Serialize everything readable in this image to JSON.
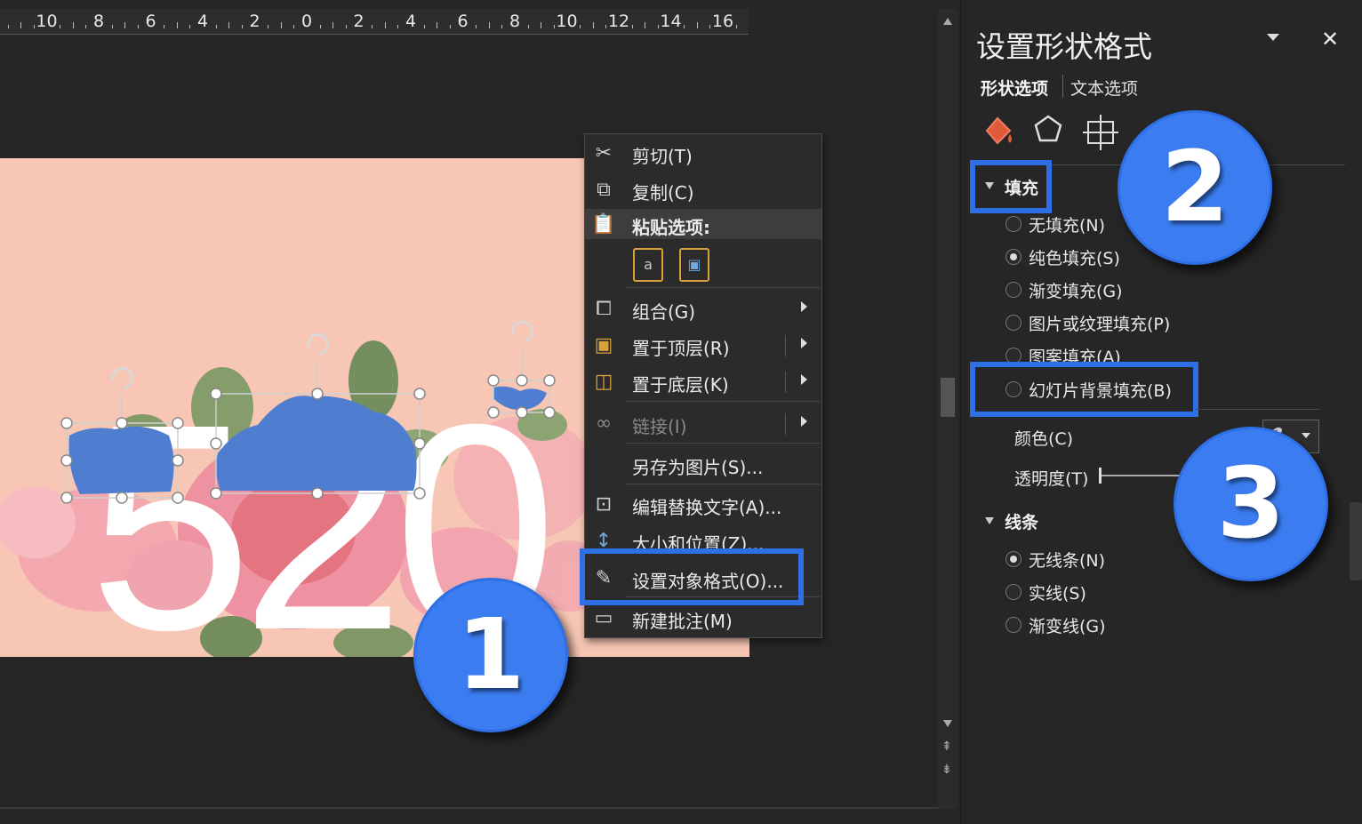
{
  "ruler": {
    "numbers": [
      "2",
      "10",
      "8",
      "6",
      "4",
      "2",
      "0",
      "2",
      "4",
      "6",
      "8",
      "10",
      "12",
      "14",
      "16"
    ]
  },
  "slide": {
    "big_text": "520",
    "background": "#f7c6b4",
    "shape_color": "#4f7dcf"
  },
  "context_menu": {
    "items": [
      {
        "label": "剪切(T)",
        "icon": "scissors-icon"
      },
      {
        "label": "复制(C)",
        "icon": "copy-icon"
      },
      {
        "label": "粘贴选项:",
        "icon": "paste-icon"
      },
      {
        "label": "组合(G)",
        "icon": "group-icon"
      },
      {
        "label": "置于顶层(R)",
        "icon": "bring-to-front-icon"
      },
      {
        "label": "置于底层(K)",
        "icon": "send-to-back-icon"
      },
      {
        "label": "链接(I)",
        "icon": "link-icon"
      },
      {
        "label": "另存为图片(S)...",
        "icon": ""
      },
      {
        "label": "编辑替换文字(A)...",
        "icon": "alt-text-icon"
      },
      {
        "label": "大小和位置(Z)...",
        "icon": "size-position-icon"
      },
      {
        "label": "设置对象格式(O)...",
        "icon": "format-object-icon"
      },
      {
        "label": "新建批注(M)",
        "icon": "new-comment-icon"
      }
    ]
  },
  "panel": {
    "title": "设置形状格式",
    "tab_shape": "形状选项",
    "tab_text": "文本选项",
    "fill_section": "填充",
    "fill_options": [
      {
        "label": "无填充(N)",
        "selected": false
      },
      {
        "label": "纯色填充(S)",
        "selected": true
      },
      {
        "label": "渐变填充(G)",
        "selected": false
      },
      {
        "label": "图片或纹理填充(P)",
        "selected": false
      },
      {
        "label": "图案填充(A)",
        "selected": false
      },
      {
        "label": "幻灯片背景填充(B)",
        "selected": false
      }
    ],
    "color_label": "颜色(C)",
    "transparency_label": "透明度(T)",
    "line_section": "线条",
    "line_options": [
      {
        "label": "无线条(N)",
        "selected": true
      },
      {
        "label": "实线(S)",
        "selected": false
      },
      {
        "label": "渐变线(G)",
        "selected": false
      }
    ]
  },
  "callouts": [
    "1",
    "2",
    "3"
  ],
  "colors": {
    "highlight": "#2f6fe6",
    "badge": "#3b7cf0",
    "dark_bg": "#262626"
  }
}
